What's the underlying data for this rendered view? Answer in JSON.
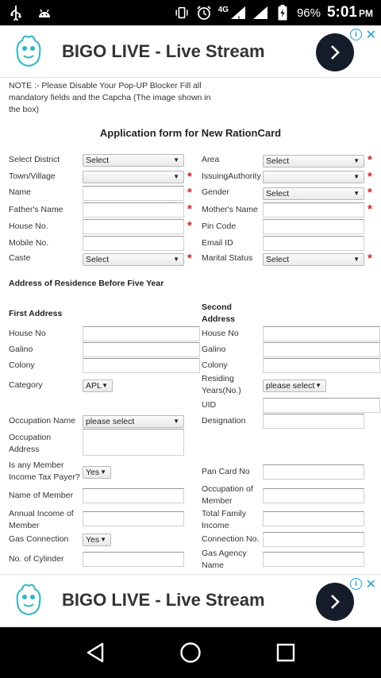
{
  "status_bar": {
    "battery": "96%",
    "network": "4G",
    "time": "5:01",
    "ampm": "PM"
  },
  "ad": {
    "title": "BIGO LIVE - Live Stream",
    "info": "i",
    "close": "✕"
  },
  "note": "NOTE :- Please Disable Your Pop-UP Blocker Fill all mandatory fields and the Capcha (The image shown in the box)",
  "form_title": "Application form for New RationCard",
  "labels": {
    "select_district": "Select District",
    "area": "Area",
    "town_village": "Town/Village",
    "issuing_authority": "IssuingAuthority",
    "name": "Name",
    "gender": "Gender",
    "fathers_name": "Father's Name",
    "mothers_name": "Mother's Name",
    "house_no_top": "House No.",
    "pin_code": "Pin Code",
    "mobile_no": "Mobile No.",
    "email_id": "Email ID",
    "caste": "Caste",
    "marital_status": "Marital Status",
    "address_section": "Address of Residence Before Five Year",
    "first_address": "First Address",
    "second_address": "Second Address",
    "house_no": "House No",
    "galino": "Galino",
    "colony": "Colony",
    "category": "Category",
    "residing_years": "Residing Years(No.)",
    "uid": "UID",
    "occupation_name": "Occupation Name",
    "designation": "Designation",
    "occupation_address": "Occupation Address",
    "income_tax": "Is any Member Income Tax Payer?",
    "pan_card": "Pan Card No",
    "name_of_member": "Name of Member",
    "occupation_of_member": "Occupation of Member",
    "annual_income": "Annual Income of Member",
    "total_family_income": "Total Family Income",
    "gas_connection": "Gas Connection",
    "connection_no": "Connection No.",
    "no_of_cylinder": "No. of Cylinder",
    "gas_agency_name": "Gas Agency Name"
  },
  "selects": {
    "district": "Select",
    "area": "Select",
    "town": "",
    "issuing_authority": "",
    "gender": "Select",
    "caste": "Select",
    "marital_status": "Select",
    "category": "APL",
    "residing_years": "please select",
    "occupation_name": "please select",
    "income_tax": "Yes",
    "gas_connection": "Yes"
  },
  "required_mark": "*",
  "colors": {
    "required": "#e02020",
    "ad_accent": "#19a0e0",
    "ad_button": "#161d2a"
  }
}
